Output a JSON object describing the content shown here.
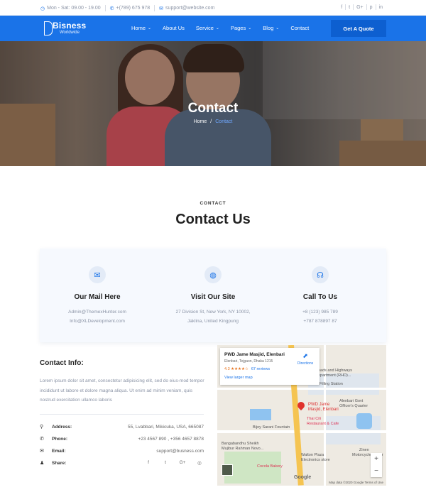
{
  "topbar": {
    "hours": "Mon - Sat: 09.00 - 19.00",
    "phone": "+(789) 675 978",
    "email": "support@website.com",
    "social": [
      "f",
      "t",
      "G+",
      "p",
      "in"
    ]
  },
  "nav": {
    "logo_name": "Bisness",
    "logo_sub": "Worldwide",
    "menu": [
      {
        "label": "Home",
        "dropdown": true
      },
      {
        "label": "About Us",
        "dropdown": false
      },
      {
        "label": "Service",
        "dropdown": true
      },
      {
        "label": "Pages",
        "dropdown": true
      },
      {
        "label": "Blog",
        "dropdown": true
      },
      {
        "label": "Contact",
        "dropdown": false
      }
    ],
    "cta": "Get A Quote"
  },
  "hero": {
    "title": "Contact",
    "breadcrumb_home": "Home",
    "breadcrumb_sep": "/",
    "breadcrumb_current": "Contact"
  },
  "section": {
    "eyebrow": "CONTACT",
    "title": "Contact Us"
  },
  "cards": [
    {
      "icon": "mail-icon",
      "glyph": "✉",
      "title": "Our Mail Here",
      "lines": [
        "Admin@ThemexHunter.com",
        "Info@XLDevelopment.com"
      ]
    },
    {
      "icon": "globe-icon",
      "glyph": "◍",
      "title": "Visit Our Site",
      "lines": [
        "27 Division St, New York, NY 10002,",
        "Jaklina, United Kingpung"
      ]
    },
    {
      "icon": "headset-icon",
      "glyph": "☊",
      "title": "Call To Us",
      "lines": [
        "+8 (123) 985 789",
        "+787 878897 87"
      ]
    }
  ],
  "contact_info": {
    "title": "Contact Info:",
    "text": "Lorem ipsum dolor sit amet, consectetur adipisicing elit, sed do eius-mod tempor incididunt ut labore et dolore magna aliqua. Ut enim ad minim veniam, quis nostrud exercitation ullamco laboris",
    "rows": [
      {
        "icon": "location-pin-icon",
        "glyph": "⚲",
        "label": "Address:",
        "value": "55, Lvabbari, Mikicuka, USA, 665087"
      },
      {
        "icon": "phone-icon",
        "glyph": "✆",
        "label": "Phone:",
        "value": "+23 4567 890 , +356 4657 8878"
      },
      {
        "icon": "envelope-icon",
        "glyph": "✉",
        "label": "Email:",
        "value": "support@busness.com"
      }
    ],
    "share_label": "Share:",
    "share_icons": [
      "f",
      "t",
      "G+",
      "◎"
    ]
  },
  "map": {
    "place": "PWD Jame Masjid, Elenbari",
    "address": "Elenbari, Tejgaon, Dhaka 1215",
    "rating": "4.3 ★★★★☆",
    "reviews": "67 reviews",
    "larger_map": "View larger map",
    "directions": "Directions",
    "pin_label_1": "PWD Jame",
    "pin_label_2": "Masjid, Elenbari",
    "labels": {
      "roads_dept": "Roads and Highways",
      "roads_dept_2": "Department (RHD)...",
      "trust": "Trust Filling Station",
      "govt": "Alenbari Govt",
      "govt_2": "Officer's Quarter",
      "cafe": "Thai Cili",
      "cafe_2": "Restaurant & Cafe",
      "bijoy": "Bijoy Sarani Fountain",
      "bangabandhu": "Bangabandhu Sheikh",
      "bangabandhu_2": "Mujibur Rahman Novo...",
      "walton": "Walton Plaza",
      "walton_2": "Electronics store",
      "zinen": "Zinen",
      "zinen_2": "Motorcycle dealer",
      "cocola": "Cocola Bakery",
      "google": "Google",
      "footer": "Map data ©2020 Google   Terms of Use"
    },
    "zoom_in": "+",
    "zoom_out": "−"
  }
}
